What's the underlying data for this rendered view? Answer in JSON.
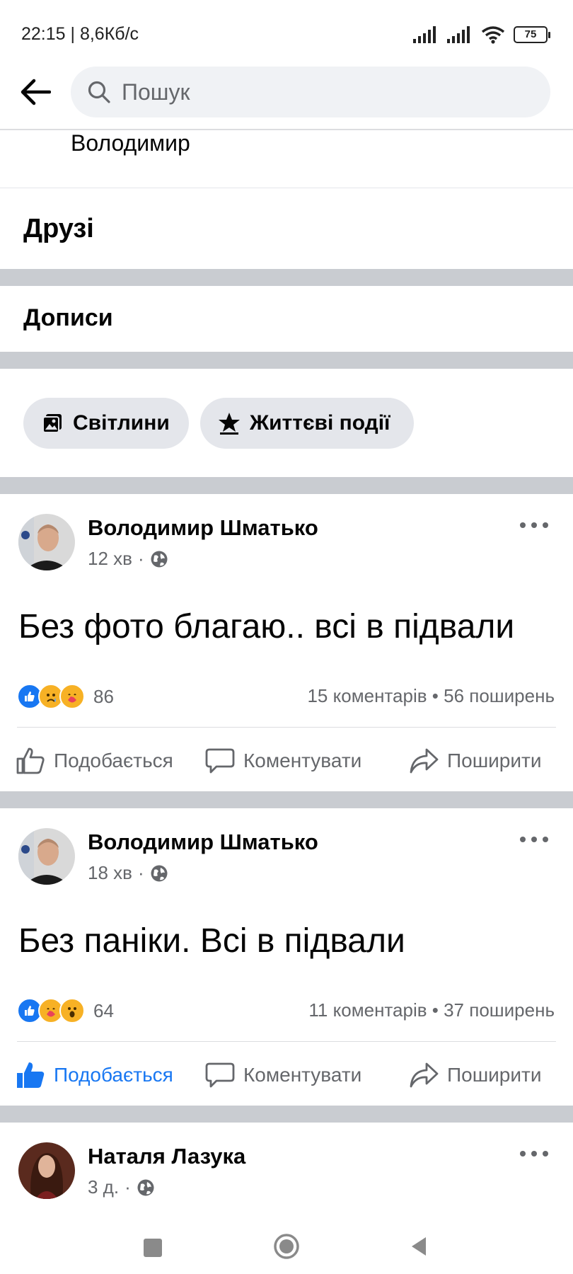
{
  "status_bar": {
    "time": "22:15 | 8,6Кб/с",
    "battery": "75"
  },
  "search": {
    "placeholder": "Пошук"
  },
  "profile": {
    "name_partial": "Володимир"
  },
  "sections": {
    "friends": "Друзі",
    "posts": "Дописи"
  },
  "chips": [
    {
      "label": "Світлини",
      "icon": "photos-icon"
    },
    {
      "label": "Життєві події",
      "icon": "life-events-star-icon"
    }
  ],
  "posts": [
    {
      "author": "Володимир Шматько",
      "time": "12 хв",
      "audience_icon": "globe-icon",
      "text": "Без фото благаю.. всі в підвали",
      "reactions": [
        "like",
        "care-sad",
        "care"
      ],
      "reaction_count": "86",
      "stats": "15 коментарів • 56 поширень",
      "liked": false
    },
    {
      "author": "Володимир Шматько",
      "time": "18 хв",
      "audience_icon": "globe-icon",
      "text": "Без паніки. Всі в підвали",
      "reactions": [
        "like",
        "care",
        "wow"
      ],
      "reaction_count": "64",
      "stats": "11 коментарів • 37 поширень",
      "liked": true
    },
    {
      "author": "Наталя Лазука",
      "time": "3 д.",
      "audience_icon": "globe-icon"
    }
  ],
  "actions": {
    "like": "Подобається",
    "comment": "Коментувати",
    "share": "Поширити"
  },
  "colors": {
    "accent": "#1877f2",
    "separator": "#c9ccd1",
    "muted": "#65676b"
  }
}
